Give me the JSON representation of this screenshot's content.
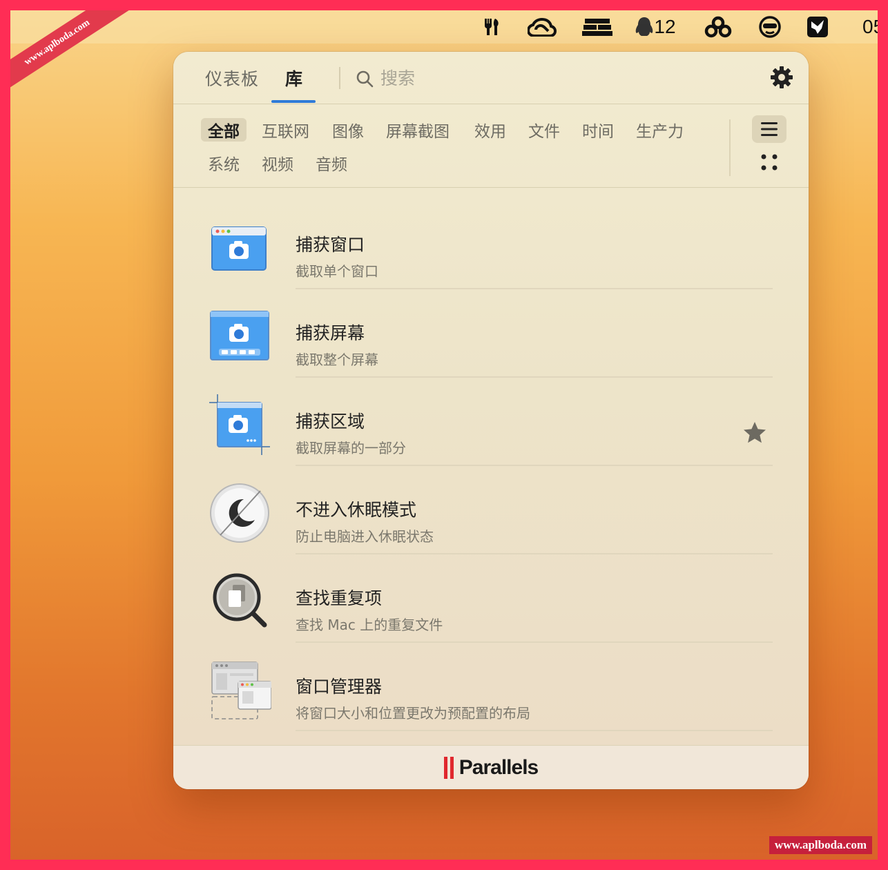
{
  "menubar": {
    "qq_badge_count": "12",
    "clock_partial": "05"
  },
  "watermarks": {
    "ribbon": "www.aplboda.com",
    "corner": "www.aplboda.com"
  },
  "header": {
    "tabs": [
      {
        "label": "仪表板",
        "active": false
      },
      {
        "label": "库",
        "active": true
      }
    ],
    "search_placeholder": "搜索",
    "accent_color": "#2f7bd8"
  },
  "categories": [
    {
      "label": "全部",
      "active": true
    },
    {
      "label": "互联网",
      "active": false
    },
    {
      "label": "图像",
      "active": false
    },
    {
      "label": "屏幕截图",
      "active": false
    },
    {
      "label": "效用",
      "active": false
    },
    {
      "label": "文件",
      "active": false
    },
    {
      "label": "时间",
      "active": false
    },
    {
      "label": "生产力",
      "active": false
    },
    {
      "label": "系统",
      "active": false
    },
    {
      "label": "视频",
      "active": false
    },
    {
      "label": "音频",
      "active": false
    }
  ],
  "tools": [
    {
      "title": "捕获窗口",
      "description": "截取单个窗口",
      "icon": "capture-window-icon",
      "favorite": false
    },
    {
      "title": "捕获屏幕",
      "description": "截取整个屏幕",
      "icon": "capture-screen-icon",
      "favorite": false
    },
    {
      "title": "捕获区域",
      "description": "截取屏幕的一部分",
      "icon": "capture-area-icon",
      "favorite": true
    },
    {
      "title": "不进入休眠模式",
      "description": "防止电脑进入休眠状态",
      "icon": "no-sleep-icon",
      "favorite": false
    },
    {
      "title": "查找重复项",
      "description": "查找 Mac 上的重复文件",
      "icon": "find-duplicates-icon",
      "favorite": false
    },
    {
      "title": "窗口管理器",
      "description": "将窗口大小和位置更改为预配置的布局",
      "icon": "window-manager-icon",
      "favorite": false
    }
  ],
  "footer": {
    "brand": "Parallels",
    "brand_color": "#e0282e"
  }
}
